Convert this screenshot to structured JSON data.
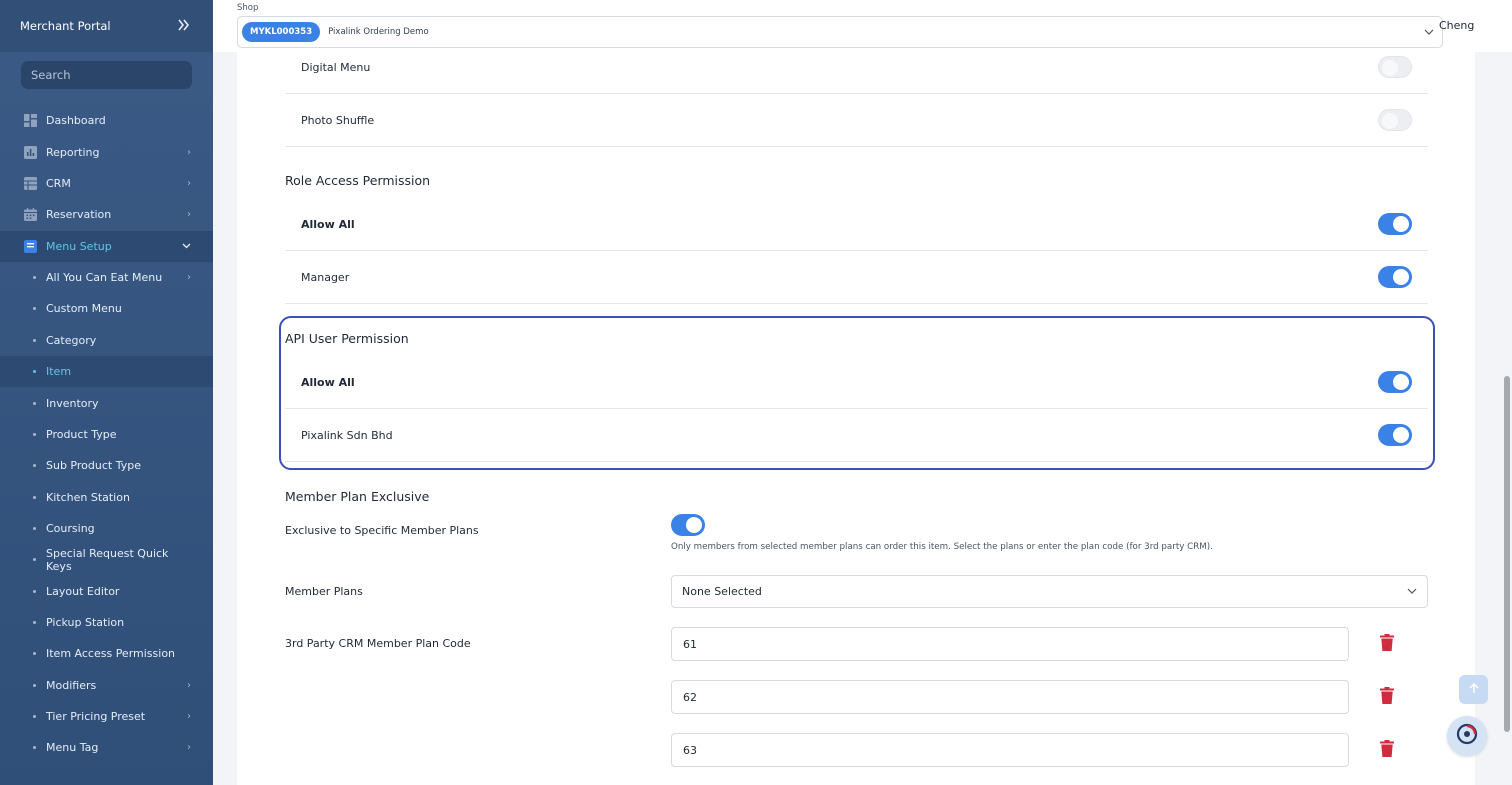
{
  "sidebar": {
    "title": "Merchant Portal",
    "search_placeholder": "Search",
    "items": [
      {
        "label": "Dashboard",
        "icon": "dashboard-icon",
        "has_chevron": false
      },
      {
        "label": "Reporting",
        "icon": "chart-icon",
        "has_chevron": true
      },
      {
        "label": "CRM",
        "icon": "table-icon",
        "has_chevron": true
      },
      {
        "label": "Reservation",
        "icon": "calendar-icon",
        "has_chevron": true
      },
      {
        "label": "Menu Setup",
        "icon": "book-icon",
        "has_chevron": true,
        "expanded": true
      }
    ],
    "sub_items": [
      {
        "label": "All You Can Eat Menu",
        "has_chevron": true
      },
      {
        "label": "Custom Menu"
      },
      {
        "label": "Category"
      },
      {
        "label": "Item",
        "current": true
      },
      {
        "label": "Inventory"
      },
      {
        "label": "Product Type"
      },
      {
        "label": "Sub Product Type"
      },
      {
        "label": "Kitchen Station"
      },
      {
        "label": "Coursing"
      },
      {
        "label": "Special Request Quick Keys"
      },
      {
        "label": "Layout Editor"
      },
      {
        "label": "Pickup Station"
      },
      {
        "label": "Item Access Permission"
      },
      {
        "label": "Modifiers",
        "has_chevron": true
      },
      {
        "label": "Tier Pricing Preset",
        "has_chevron": true
      },
      {
        "label": "Menu Tag",
        "has_chevron": true
      }
    ]
  },
  "topbar": {
    "shop_label": "Shop",
    "shop_code": "MYKL000353",
    "shop_name": "Pixalink Ordering Demo",
    "user_name": "Cheng"
  },
  "main": {
    "display_rows": [
      {
        "label": "Digital Menu",
        "enabled": false
      },
      {
        "label": "Photo Shuffle",
        "enabled": false
      }
    ],
    "role_access": {
      "title": "Role Access Permission",
      "rows": [
        {
          "label": "Allow All",
          "enabled": true
        },
        {
          "label": "Manager",
          "enabled": true
        }
      ]
    },
    "api_user": {
      "title": "API User Permission",
      "rows": [
        {
          "label": "Allow All",
          "enabled": true
        },
        {
          "label": "Pixalink Sdn Bhd",
          "enabled": true
        }
      ]
    },
    "member_plan": {
      "title": "Member Plan Exclusive",
      "exclusive_label": "Exclusive to Specific Member Plans",
      "exclusive_enabled": true,
      "helper_text": "Only members from selected member plans can order this item. Select the plans or enter the plan code (for 3rd party CRM).",
      "plans_label": "Member Plans",
      "plans_value": "None Selected",
      "crm_code_label": "3rd Party CRM Member Plan Code",
      "codes": [
        "61",
        "62",
        "63"
      ]
    }
  },
  "colors": {
    "accent": "#3b82e6",
    "sidebar_bg": "#34547f",
    "active_text": "#5ec8e5",
    "highlight_border": "#3b4fb8",
    "delete": "#d12b3f"
  }
}
